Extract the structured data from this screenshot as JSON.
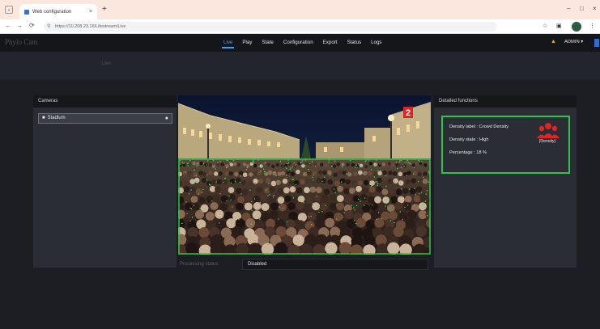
{
  "browser": {
    "tab_title": "Web configuration",
    "url": "https://10.208.23.16/Lifestream/Live",
    "tab_close": "×",
    "new_tab": "+",
    "window_controls": [
      "–",
      "□",
      "×"
    ],
    "nav_back": "←",
    "nav_forward": "→",
    "nav_reload": "⟳"
  },
  "app": {
    "brand": "Phylo Cam",
    "nav": [
      "Live",
      "Play",
      "State",
      "Configuration",
      "Export",
      "Status",
      "Logs"
    ],
    "active_nav": "Live",
    "user": "ADMIN ▾",
    "page_title": "Live"
  },
  "cameras": {
    "header": "Cameras",
    "items": [
      {
        "label": "Stadium"
      }
    ]
  },
  "video": {
    "overlay_badge": "2"
  },
  "processing": {
    "label": "Processing status",
    "value": "Disabled"
  },
  "detail": {
    "header": "Detailed functions",
    "density_label": "Density label : Crowd Density",
    "density_state": "Density state : High",
    "percentage": "Percentage : 18 %",
    "icon_caption": "(Density)"
  },
  "colors": {
    "accent": "#3aa0ff",
    "detection": "#2ec44a",
    "alert": "#e02424"
  }
}
